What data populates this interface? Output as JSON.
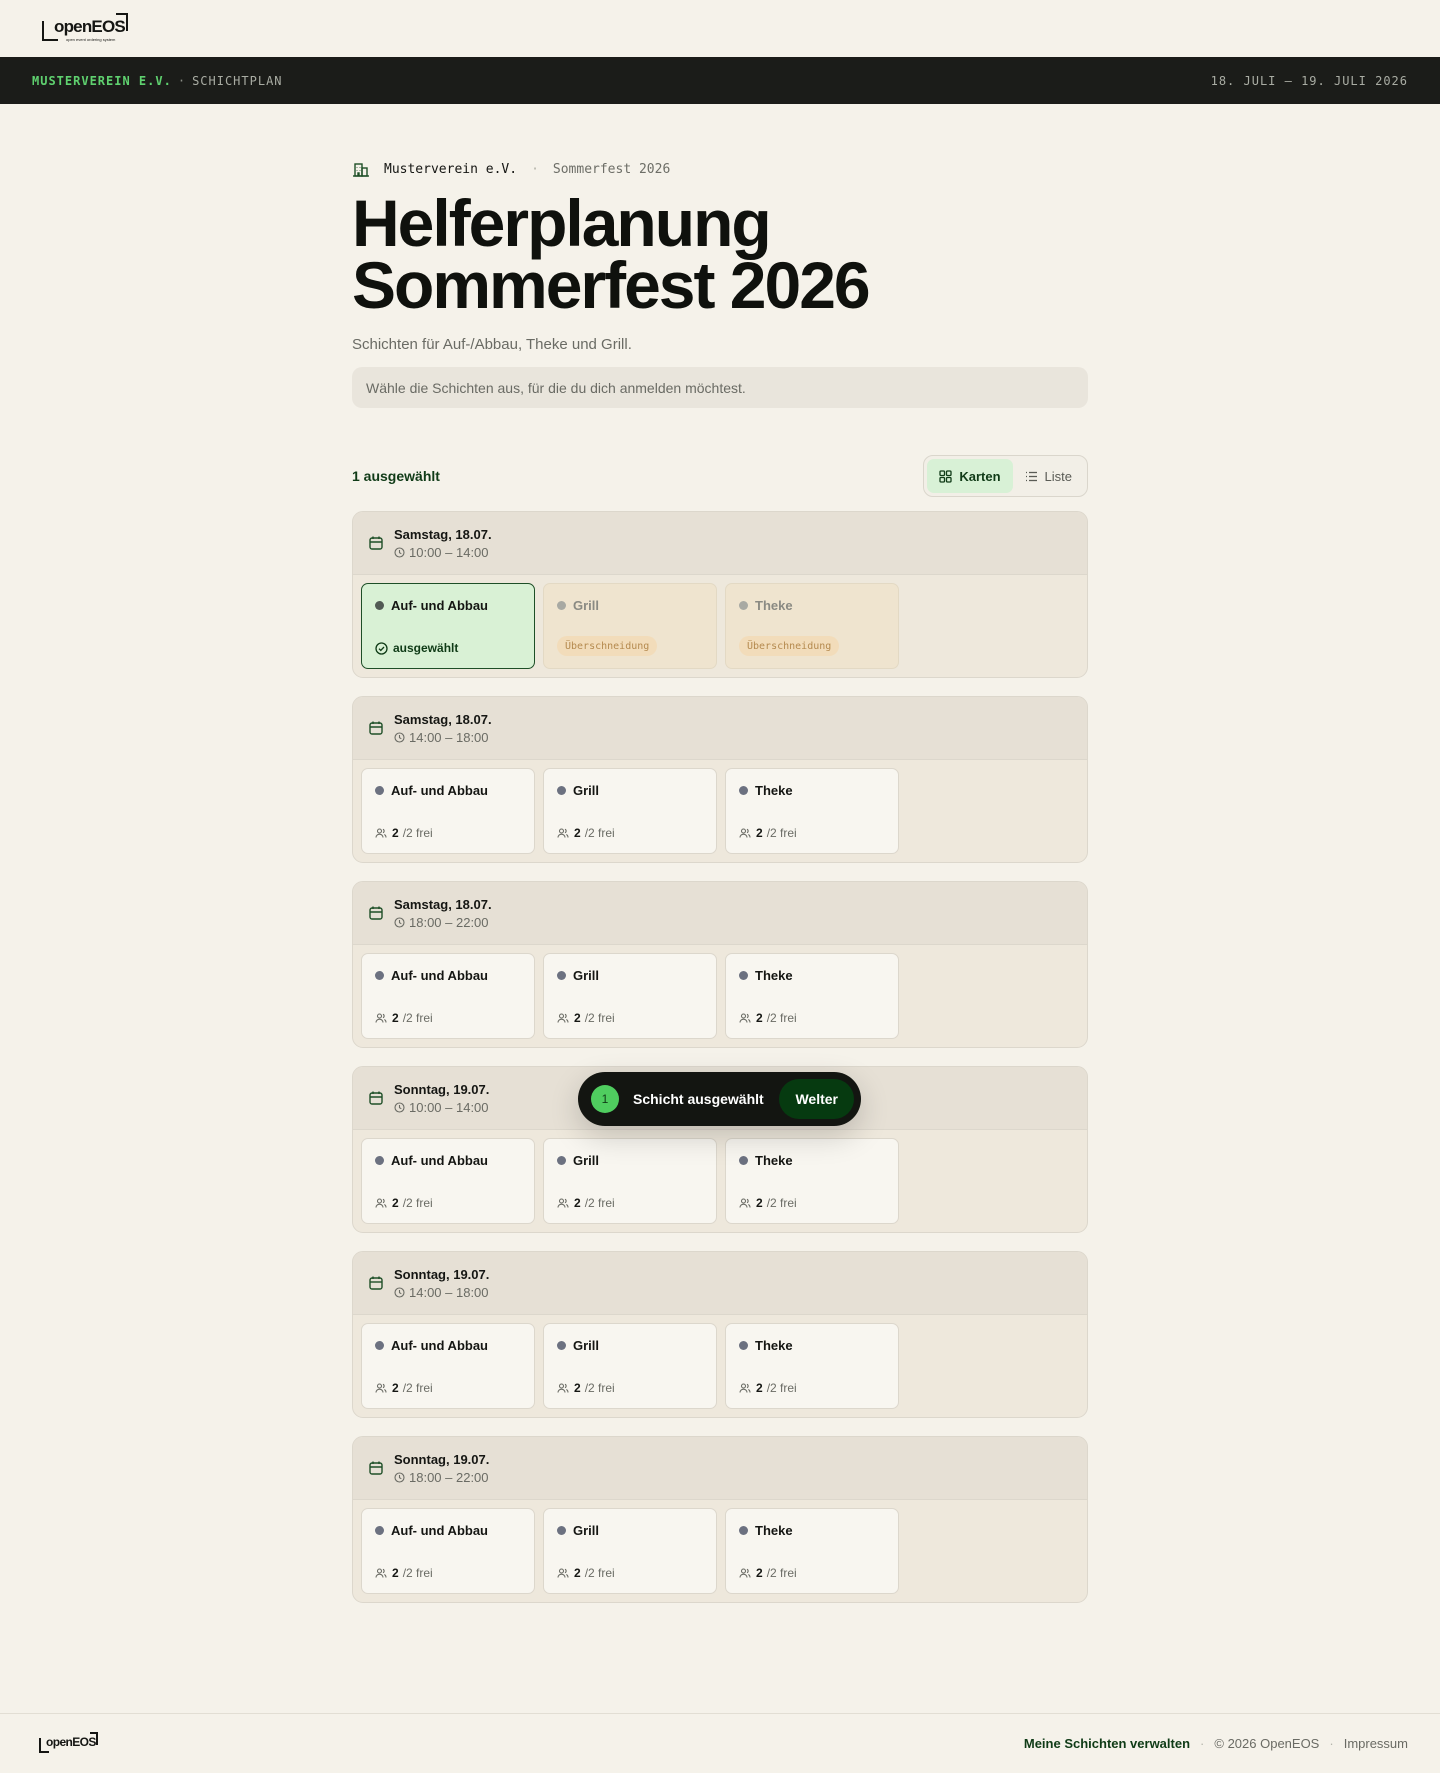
{
  "brand": {
    "logo_word": "openEOS",
    "logo_tagline": "open event ordering system"
  },
  "darkbar": {
    "org": "MUSTERVEREIN E.V.",
    "separator": "·",
    "section": "SCHICHTPLAN",
    "dates": "18. JULI – 19. JULI 2026"
  },
  "crumb": {
    "icon": "building-icon",
    "org": "Musterverein e.V.",
    "separator": "·",
    "event": "Sommerfest 2026"
  },
  "title_line1": "Helferplanung",
  "title_line2": "Sommerfest 2026",
  "subtitle": "Schichten für Auf-/Abbau, Theke und Grill.",
  "hint": "Wähle die Schichten aus, für die du dich anmelden möchtest.",
  "selected_count": "1 ausgewählt",
  "view_toggle": {
    "cards": "Karten",
    "list": "Liste",
    "active": "cards"
  },
  "slots": [
    {
      "day": "Samstag, 18.07.",
      "time": "10:00 – 14:00",
      "cards": [
        {
          "name": "Auf- und Abbau",
          "state": "selected",
          "status": "ausgewählt"
        },
        {
          "name": "Grill",
          "state": "overlap",
          "status": "Überschneidung"
        },
        {
          "name": "Theke",
          "state": "overlap",
          "status": "Überschneidung"
        }
      ]
    },
    {
      "day": "Samstag, 18.07.",
      "time": "14:00 – 18:00",
      "cards": [
        {
          "name": "Auf- und Abbau",
          "state": "free",
          "free": "2",
          "total": "/2 frei"
        },
        {
          "name": "Grill",
          "state": "free",
          "free": "2",
          "total": "/2 frei"
        },
        {
          "name": "Theke",
          "state": "free",
          "free": "2",
          "total": "/2 frei"
        }
      ]
    },
    {
      "day": "Samstag, 18.07.",
      "time": "18:00 – 22:00",
      "cards": [
        {
          "name": "Auf- und Abbau",
          "state": "free",
          "free": "2",
          "total": "/2 frei"
        },
        {
          "name": "Grill",
          "state": "free",
          "free": "2",
          "total": "/2 frei"
        },
        {
          "name": "Theke",
          "state": "free",
          "free": "2",
          "total": "/2 frei"
        }
      ]
    },
    {
      "day": "Sonntag, 19.07.",
      "time": "10:00 – 14:00",
      "cards": [
        {
          "name": "Auf- und Abbau",
          "state": "free",
          "free": "2",
          "total": "/2 frei"
        },
        {
          "name": "Grill",
          "state": "free",
          "free": "2",
          "total": "/2 frei"
        },
        {
          "name": "Theke",
          "state": "free",
          "free": "2",
          "total": "/2 frei"
        }
      ]
    },
    {
      "day": "Sonntag, 19.07.",
      "time": "14:00 – 18:00",
      "cards": [
        {
          "name": "Auf- und Abbau",
          "state": "free",
          "free": "2",
          "total": "/2 frei"
        },
        {
          "name": "Grill",
          "state": "free",
          "free": "2",
          "total": "/2 frei"
        },
        {
          "name": "Theke",
          "state": "free",
          "free": "2",
          "total": "/2 frei"
        }
      ]
    },
    {
      "day": "Sonntag, 19.07.",
      "time": "18:00 – 22:00",
      "cards": [
        {
          "name": "Auf- und Abbau",
          "state": "free",
          "free": "2",
          "total": "/2 frei"
        },
        {
          "name": "Grill",
          "state": "free",
          "free": "2",
          "total": "/2 frei"
        },
        {
          "name": "Theke",
          "state": "free",
          "free": "2",
          "total": "/2 frei"
        }
      ]
    }
  ],
  "floatbar": {
    "count": "1",
    "text": "Schicht ausgewählt",
    "button": "Welter"
  },
  "footer": {
    "manage": "Meine Schichten verwalten",
    "separator": "·",
    "copyright": "© 2026 OpenEOS",
    "imprint": "Impressum"
  },
  "colors": {
    "accent_green": "#4fcd5f",
    "dark_green": "#063a10",
    "selected_bg": "#d9f1d5",
    "overlap_bg": "#efe4cf",
    "page_bg": "#f5f2ea"
  }
}
